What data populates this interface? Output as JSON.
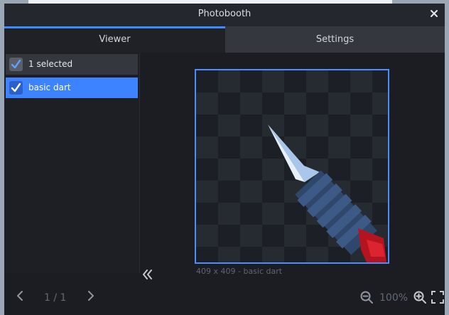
{
  "window": {
    "title": "Photobooth"
  },
  "tabs": [
    {
      "label": "Viewer",
      "active": true
    },
    {
      "label": "Settings",
      "active": false
    }
  ],
  "list": {
    "header": {
      "label": "1 selected",
      "checked": true
    },
    "items": [
      {
        "label": "basic dart",
        "checked": true,
        "selected": true
      }
    ]
  },
  "preview": {
    "caption": "409 x 409 - basic dart"
  },
  "pagination": {
    "current": "1 / 1"
  },
  "zoom": {
    "level": "100%"
  },
  "colors": {
    "accent": "#3d82ff",
    "background": "#1b1d22"
  },
  "icons": {
    "close": "close-icon",
    "check": "check-icon",
    "collapse": "double-chevron-left-icon",
    "prev": "chevron-left-icon",
    "next": "chevron-right-icon",
    "zoom_out": "zoom-out-icon",
    "zoom_in": "zoom-in-icon",
    "fit": "fullscreen-icon"
  }
}
